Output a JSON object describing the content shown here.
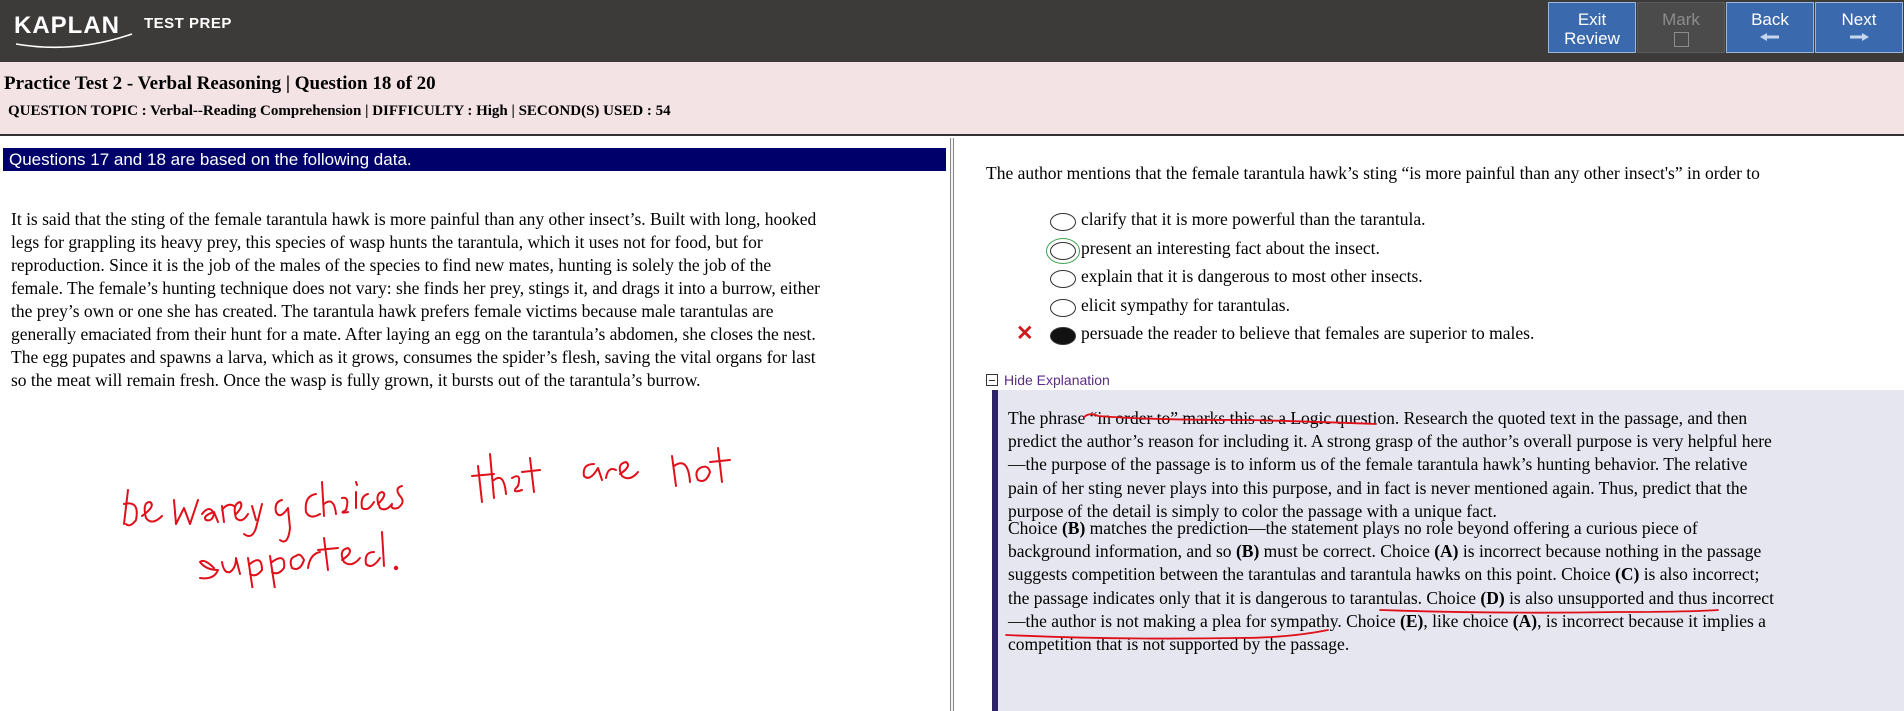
{
  "topbar": {
    "logo_main": "KAPLAN",
    "logo_sub": "TEST PREP",
    "buttons": {
      "exit_line1": "Exit",
      "exit_line2": "Review",
      "mark": "Mark",
      "back": "Back",
      "next": "Next"
    }
  },
  "header": {
    "title": "Practice Test 2 - Verbal Reasoning | Question  18 of 20",
    "topic_line": "QUESTION TOPIC : Verbal--Reading Comprehension | DIFFICULTY : High | SECOND(S) USED : 54"
  },
  "left": {
    "banner": "Questions 17 and 18 are based on the following data.",
    "passage_lines": [
      "It is said that the sting of the female tarantula hawk is more painful than any other insect’s. Built with long, hooked",
      "legs for grappling its heavy prey, this species of wasp hunts the tarantula, which it uses not for food, but for",
      "reproduction. Since it is the job of the males of the species to find new mates, hunting is solely the job of the",
      "female. The female’s hunting technique does not vary: she finds her prey, stings it, and drags it into a burrow, either",
      "the prey’s own or one she has created. The tarantula hawk prefers female victims because male tarantulas are",
      "generally emaciated from their hunt for a mate. After laying an egg on the tarantula’s abdomen, she closes the nest.",
      "The egg pupates and spawns a larva, which as it grows, consumes the spider’s flesh, saving the vital organs for last",
      "so the meat will remain fresh. Once the wasp is fully grown, it bursts out of the tarantula’s burrow."
    ],
    "handwritten_note": [
      "be wary of choices that are not",
      "supported."
    ]
  },
  "right": {
    "stem": "The author mentions that the female tarantula hawk’s sting “is more painful than any other insect's” in order to",
    "choices": [
      {
        "text": "clarify that it is more powerful than the tarantula.",
        "selected": false
      },
      {
        "text": "present an interesting fact about the insect.",
        "selected": false,
        "correct": true
      },
      {
        "text": "explain that it is dangerous to most other insects.",
        "selected": false
      },
      {
        "text": "elicit sympathy for tarantulas.",
        "selected": false
      },
      {
        "text": "persuade the reader to believe that females are superior to males.",
        "selected": true,
        "mark": "✕"
      }
    ],
    "hide_explanation": "Hide Explanation",
    "explanation": {
      "p1_lines": [
        "The phrase “in order to” marks this as a Logic question. Research the quoted text in the passage, and then",
        "predict the author’s reason for including it. A strong grasp of the author’s overall purpose is very helpful here",
        "—the purpose of the passage is to inform us of the female tarantula hawk’s hunting behavior. The relative",
        "pain of her sting never plays into this purpose, and in fact is never mentioned again. Thus, predict that the",
        "purpose of the detail is simply to color the passage with a unique fact."
      ],
      "p2_lines": [
        [
          {
            "t": "Choice "
          },
          {
            "t": "(B)",
            "b": true
          },
          {
            "t": " matches the prediction—the statement plays no role beyond offering a curious piece of"
          }
        ],
        [
          {
            "t": "background information, and so "
          },
          {
            "t": "(B)",
            "b": true
          },
          {
            "t": " must be correct. Choice "
          },
          {
            "t": "(A)",
            "b": true
          },
          {
            "t": " is incorrect because nothing in the passage"
          }
        ],
        [
          {
            "t": "suggests competition between the tarantulas and tarantula hawks on this point. Choice "
          },
          {
            "t": "(C)",
            "b": true
          },
          {
            "t": " is also incorrect;"
          }
        ],
        [
          {
            "t": "the passage indicates only that it is dangerous to tarantulas. Choice "
          },
          {
            "t": "(D)",
            "b": true
          },
          {
            "t": " is also unsupported and thus incorrect"
          }
        ],
        [
          {
            "t": "—the author is not making a plea for sympathy. Choice "
          },
          {
            "t": "(E)",
            "b": true
          },
          {
            "t": ", like choice "
          },
          {
            "t": "(A)",
            "b": true
          },
          {
            "t": ", is incorrect because it implies a"
          }
        ],
        [
          {
            "t": "competition that is not supported by the passage."
          }
        ]
      ]
    }
  },
  "colors": {
    "topbar": "#3d3a3a",
    "nav_button": "#3a69ad",
    "header_band": "#f3e3e4",
    "banner": "#00006b",
    "explanation_bg": "#e6e6f0",
    "explanation_bar": "#2e2366",
    "ink": "#e0101a",
    "wrong_mark": "#d01818"
  }
}
